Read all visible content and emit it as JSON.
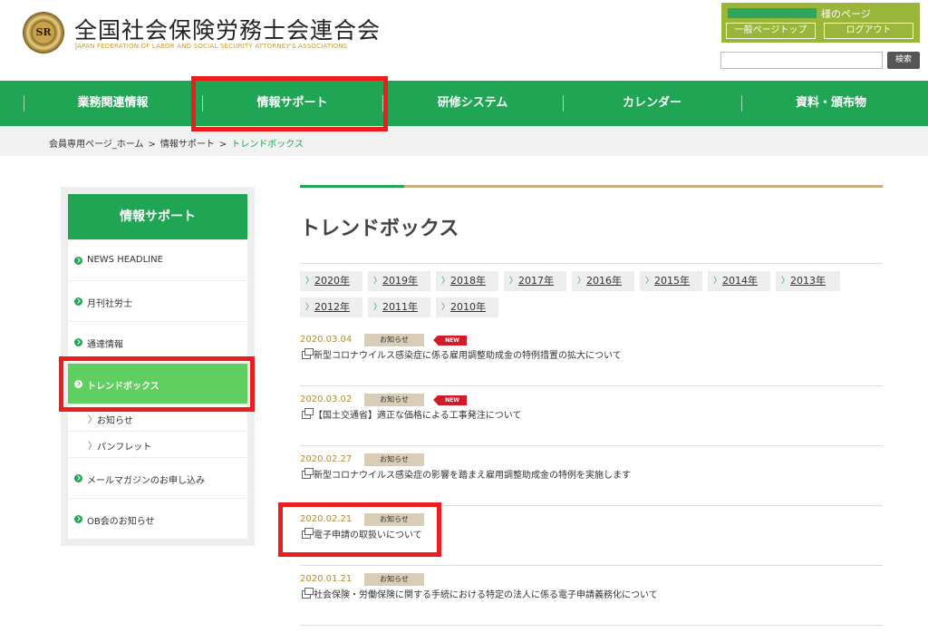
{
  "header": {
    "logo_text": "SR",
    "title": "全国社会保険労務士会連合会",
    "subtitle": "JAPAN FEDERATION OF LABOR AND SOCIAL SECURITY ATTORNEY'S ASSOCIATIONS",
    "user_suffix": "様のページ",
    "general_top_label": "一般ページトップ",
    "logout_label": "ログアウト",
    "search_placeholder": "",
    "search_button": "検索"
  },
  "nav": {
    "items": [
      {
        "label": "業務関連情報"
      },
      {
        "label": "情報サポート"
      },
      {
        "label": "研修システム"
      },
      {
        "label": "カレンダー"
      },
      {
        "label": "資料・頒布物"
      }
    ]
  },
  "breadcrumb": {
    "items": [
      "会員専用ページ_ホーム",
      "情報サポート"
    ],
    "separator": ">",
    "current": "トレンドボックス"
  },
  "sidebar": {
    "title": "情報サポート",
    "items": [
      {
        "label": "NEWS HEADLINE"
      },
      {
        "label": "月刊社労士"
      },
      {
        "label": "通達情報"
      },
      {
        "label": "トレンドボックス"
      },
      {
        "label": "メールマガジンのお申し込み"
      },
      {
        "label": "OB会のお知らせ"
      }
    ],
    "subitems": [
      {
        "label": "お知らせ"
      },
      {
        "label": "パンフレット"
      }
    ],
    "sub_chevron": "〉"
  },
  "main": {
    "title": "トレンドボックス",
    "year_chevron": "〉",
    "years": [
      "2020年",
      "2019年",
      "2018年",
      "2017年",
      "2016年",
      "2015年",
      "2014年",
      "2013年",
      "2012年",
      "2011年",
      "2010年"
    ],
    "news": [
      {
        "date": "2020.03.04",
        "badge": "お知らせ",
        "is_new": true,
        "new_label": "NEW",
        "title": "新型コロナウイルス感染症に係る雇用調整助成金の特例措置の拡大について"
      },
      {
        "date": "2020.03.02",
        "badge": "お知らせ",
        "is_new": true,
        "new_label": "NEW",
        "title": "【国土交通省】適正な価格による工事発注について"
      },
      {
        "date": "2020.02.27",
        "badge": "お知らせ",
        "is_new": false,
        "new_label": "",
        "title": "新型コロナウイルス感染症の影響を踏まえ雇用調整助成金の特例を実施します"
      },
      {
        "date": "2020.02.21",
        "badge": "お知らせ",
        "is_new": false,
        "new_label": "",
        "title": "電子申請の取扱いについて"
      },
      {
        "date": "2020.01.21",
        "badge": "お知らせ",
        "is_new": false,
        "new_label": "",
        "title": "社会保険・労働保険に関する手続における特定の法人に係る電子申請義務化について"
      }
    ]
  },
  "colors": {
    "brand_green": "#1fa553",
    "active_green": "#5fcf5f",
    "gold": "#b08a3e",
    "annotation_red": "#ee1c1c",
    "new_badge_red": "#d11a2a"
  }
}
